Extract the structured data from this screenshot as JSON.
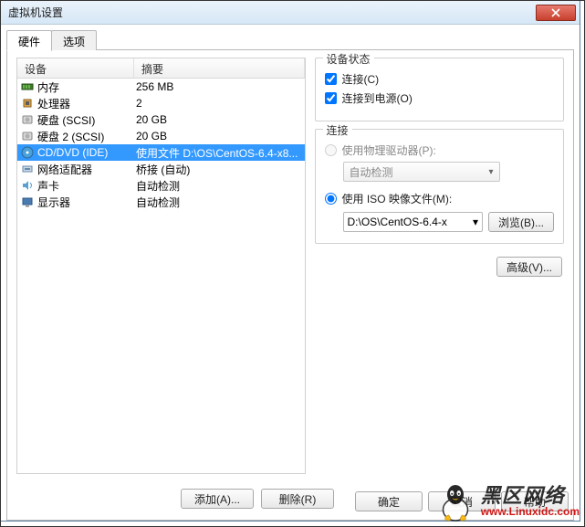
{
  "dialog": {
    "title": "虚拟机设置"
  },
  "tabs": {
    "hardware": "硬件",
    "options": "选项"
  },
  "left": {
    "header_device": "设备",
    "header_summary": "摘要",
    "rows": [
      {
        "device": "内存",
        "summary": "256 MB",
        "icon": "memory"
      },
      {
        "device": "处理器",
        "summary": "2",
        "icon": "cpu"
      },
      {
        "device": "硬盘 (SCSI)",
        "summary": "20 GB",
        "icon": "hdd"
      },
      {
        "device": "硬盘 2 (SCSI)",
        "summary": "20 GB",
        "icon": "hdd"
      },
      {
        "device": "CD/DVD (IDE)",
        "summary": "使用文件 D:\\OS\\CentOS-6.4-x8...",
        "icon": "cd",
        "selected": true
      },
      {
        "device": "网络适配器",
        "summary": "桥接 (自动)",
        "icon": "net"
      },
      {
        "device": "声卡",
        "summary": "自动检测",
        "icon": "sound"
      },
      {
        "device": "显示器",
        "summary": "自动检测",
        "icon": "display"
      }
    ],
    "add_btn": "添加(A)...",
    "remove_btn": "删除(R)"
  },
  "right": {
    "status_title": "设备状态",
    "connected": "连接(C)",
    "connect_on_power": "连接到电源(O)",
    "connection_title": "连接",
    "use_physical": "使用物理驱动器(P):",
    "auto_detect": "自动检测",
    "use_iso": "使用 ISO 映像文件(M):",
    "iso_value": "D:\\OS\\CentOS-6.4-x",
    "browse": "浏览(B)...",
    "advanced": "高级(V)..."
  },
  "footer": {
    "ok": "确定",
    "cancel": "取消",
    "help": "帮助"
  },
  "watermark": {
    "cn": "黑区网络",
    "url": "www.Linuxidc.com"
  }
}
